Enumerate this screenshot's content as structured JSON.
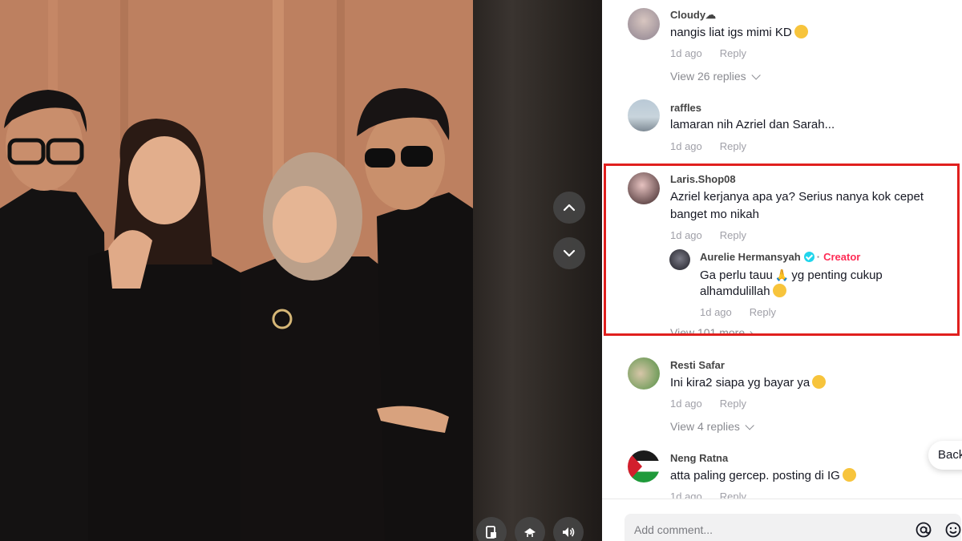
{
  "video": {
    "nav": {
      "up_icon": "chevron-up-icon",
      "down_icon": "chevron-down-icon"
    },
    "controls": [
      "picture-in-picture-icon",
      "share-icon",
      "volume-icon"
    ]
  },
  "comments": [
    {
      "user": "Cloudy☁",
      "text": "nangis liat igs mimi KD",
      "emoji": "crying-face",
      "time": "1d ago",
      "reply": "Reply",
      "view_replies": "View 26 replies"
    },
    {
      "user": "raffles",
      "text": "lamaran nih Azriel dan Sarah...",
      "time": "1d ago",
      "reply": "Reply"
    },
    {
      "user": "Laris.Shop08",
      "text_lines": [
        "Azriel kerjanya apa ya? Serius nanya kok cepet",
        "banget mo nikah"
      ],
      "time": "1d ago",
      "reply": "Reply",
      "sub_reply": {
        "user": "Aurelie Hermansyah",
        "badge": "Creator",
        "text_lines": [
          "Ga perlu tauu",
          "yg penting cukup",
          "alhamdulillah"
        ],
        "time": "1d ago",
        "reply": "Reply"
      },
      "view_more": "View 101 more"
    },
    {
      "user": "Resti Safar",
      "text": "Ini kira2 siapa yg bayar ya",
      "emoji": "crying-face",
      "time": "1d ago",
      "reply": "Reply",
      "view_replies": "View 4 replies"
    },
    {
      "user": "Neng Ratna",
      "text": "atta paling gercep. posting di IG",
      "emoji": "crying-face",
      "time": "1d ago",
      "reply": "Reply"
    }
  ],
  "back_button": "Back",
  "input": {
    "placeholder": "Add comment..."
  },
  "colors": {
    "highlight": "#e0201e",
    "creator": "#fe2c55",
    "verified": "#20d5ec"
  }
}
